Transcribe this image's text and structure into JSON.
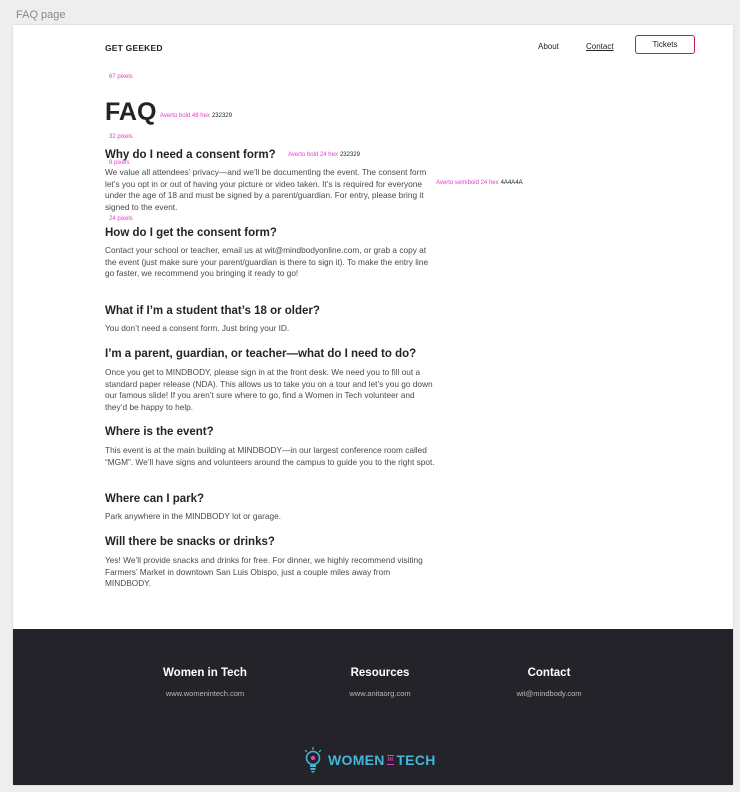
{
  "frame_label": "FAQ page",
  "header": {
    "logo": "GET GEEKED",
    "nav": {
      "about": "About",
      "contact": "Contact",
      "tickets": "Tickets"
    }
  },
  "annotations": {
    "spacing_67": "67 pixels",
    "title_style": "Averto bold 48 hex",
    "title_hex": "232329",
    "spacing_32": "32 pixels",
    "question_style": "Averto bold 24 hex",
    "question_hex": "232329",
    "spacing_8": "8 pixels",
    "answer_style": "Averto semibold 24 hex",
    "answer_hex": "4A4A4A",
    "spacing_24": "24 pixels"
  },
  "page_title": "FAQ",
  "faqs": [
    {
      "q": "Why do I need a consent form?",
      "a": "We value all attendees’ privacy—and we’ll be documenting the event. The consent form let’s you opt in or out of having your picture or video taken. It’s is required for everyone under the age of 18 and must be signed by a parent/guardian. For entry, please bring it signed to the event."
    },
    {
      "q": "How do I get the consent form?",
      "a": "Contact your school or teacher, email us at wit@mindbodyonline.com, or grab a copy at the event (just make sure your parent/guardian is there to sign it). To make the entry line go faster, we recommend you bringing it ready to go!"
    },
    {
      "q": "What if I’m a student that’s 18 or older?",
      "a": "You don’t need a consent form. Just bring your ID."
    },
    {
      "q": "I’m a parent, guardian, or teacher—what do I need to do?",
      "a": "Once you get to MINDBODY, please sign in at the front desk. We need you to fill out a standard paper release (NDA). This allows us to take you on a tour and let’s you go down our famous slide! If you aren’t sure where to go, find a Women in Tech volunteer and they’d be happy to help."
    },
    {
      "q": "Where is the event?",
      "a": "This event is at the main building at MINDBODY—in our largest conference room called “MGM”. We’ll have signs and volunteers around the campus to guide you to the right spot."
    },
    {
      "q": "Where can I park?",
      "a": "Park anywhere in the MINDBODY lot or garage."
    },
    {
      "q": "Will there be snacks or drinks?",
      "a": "Yes! We’ll provide snacks and drinks for free. For dinner, we highly recommend visiting Farmers’ Market in downtown San Luis Obispo, just a couple miles away from MINDBODY."
    }
  ],
  "footer": {
    "columns": [
      {
        "heading": "Women in Tech",
        "link": "www.womenintech.com"
      },
      {
        "heading": "Resources",
        "link": "www.anitaorg.com"
      },
      {
        "heading": "Contact",
        "link": "wit@mindbody.com"
      }
    ],
    "brand": {
      "left": "WOMEN",
      "middle": "IN",
      "right": "TECH"
    }
  },
  "colors": {
    "accent": "#c2185b",
    "annotation": "#e040c8",
    "heading": "#232329",
    "body": "#4a4a4a",
    "footer_bg": "#232329",
    "brand_blue": "#43b7d8"
  }
}
